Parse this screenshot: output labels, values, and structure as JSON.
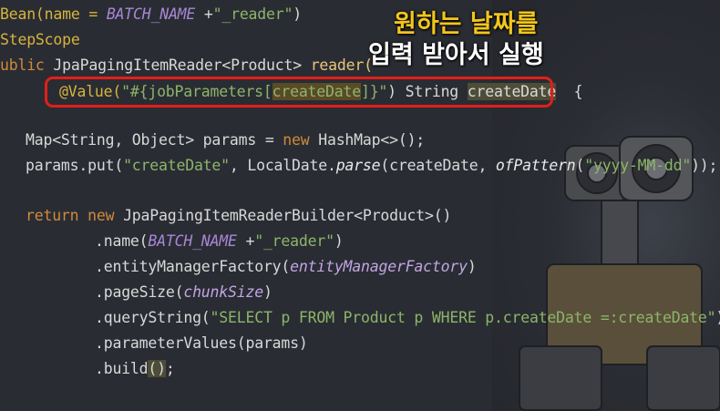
{
  "caption": {
    "line1": "원하는 날짜를",
    "line2": "입력 받아서 실행"
  },
  "code": {
    "l1": {
      "a": "Bean(name = ",
      "b": "BATCH_NAME",
      "c": " +",
      "d": "\"_reader\"",
      "e": ")"
    },
    "l2": {
      "a": "StepScope"
    },
    "l3": {
      "a": "ublic ",
      "b": "JpaPagingItemReader<Product> ",
      "c": "reader("
    },
    "l4": {
      "a": "@Value(",
      "b": "\"#{",
      "c": "jobParameters[",
      "d": "createDate",
      "e": "]",
      "f": "}\"",
      "g": ") String ",
      "h": "createDate",
      "i": "  {"
    },
    "l5": {
      "a": "Map<String, Object> params = ",
      "b": "new",
      "c": " HashMap<>();"
    },
    "l6": {
      "a": "params.put(",
      "b": "\"createDate\"",
      "c": ", LocalDate.",
      "d": "parse",
      "e": "(createDate, ",
      "f": "ofPattern",
      "g": "(",
      "h": "\"yyyy-MM-dd\"",
      "i": "));"
    },
    "l7": {
      "a": "return",
      "b": " ",
      "c": "new",
      "d": " JpaPagingItemReaderBuilder<Product>()"
    },
    "l8": {
      "a": ".name(",
      "b": "BATCH_NAME",
      "c": " +",
      "d": "\"_reader\"",
      "e": ")"
    },
    "l9": {
      "a": ".entityManagerFactory(",
      "b": "entityManagerFactory",
      "c": ")"
    },
    "l10": {
      "a": ".pageSize(",
      "b": "chunkSize",
      "c": ")"
    },
    "l11": {
      "a": ".queryString(",
      "b": "\"SELECT p FROM Product p WHERE p.createDate =:createDate\"",
      "c": ")"
    },
    "l12": {
      "a": ".parameterValues(params)"
    },
    "l13": {
      "a": ".build",
      "b": "()",
      "c": ";"
    }
  }
}
